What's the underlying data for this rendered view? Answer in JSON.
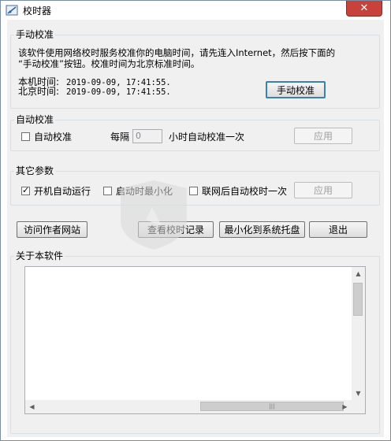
{
  "window": {
    "title": "校时器",
    "close_symbol": "✕"
  },
  "manual": {
    "group_title": "手动校准",
    "desc_line1": "该软件使用网络校时服务校准你的电脑时间，请先连入Internet，然后按下面的",
    "desc_line2": "“手动校准”按钮。校准时间为北京标准时间。",
    "local_label": "本机时间:",
    "local_value": "2019-09-09, 17:41:55.",
    "beijing_label": "北京时间:",
    "beijing_value": "2019-09-09, 17:41:55.",
    "button": "手动校准"
  },
  "auto": {
    "group_title": "自动校准",
    "checkbox_label": "自动校准",
    "checked": false,
    "interval_label": "每隔",
    "interval_value": "0",
    "interval_suffix": "小时自动校准一次",
    "apply": "应用"
  },
  "other": {
    "group_title": "其它参数",
    "options": [
      {
        "label": "开机自动运行",
        "checked": true
      },
      {
        "label": "启动时最小化",
        "checked": false
      },
      {
        "label": "联网后自动校时一次",
        "checked": false
      }
    ],
    "apply": "应用"
  },
  "actions": {
    "visit": "访问作者网站",
    "log": "查看校时记录",
    "tray": "最小化到系统托盘",
    "exit": "退出"
  },
  "about": {
    "group_title": "关于本软件"
  },
  "watermark": {
    "text": "安下载",
    "sub": "anxz.com"
  }
}
